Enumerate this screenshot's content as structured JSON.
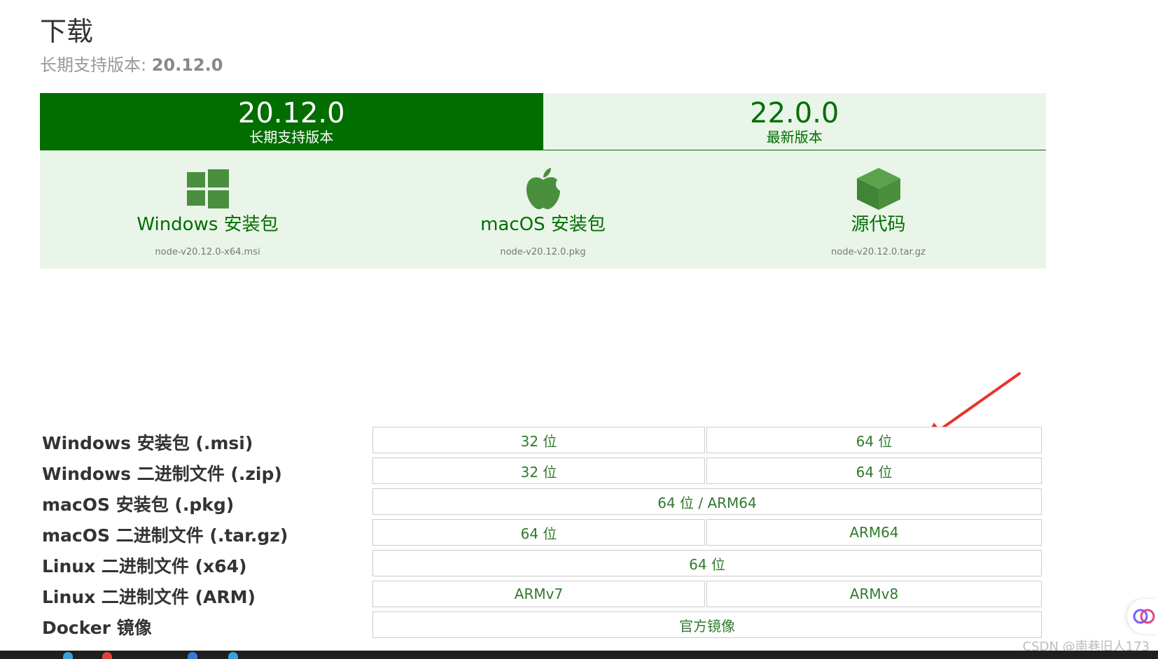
{
  "page": {
    "title": "下载",
    "subtitle_prefix": "长期支持版本: ",
    "subtitle_version": "20.12.0"
  },
  "version_tabs": [
    {
      "version": "20.12.0",
      "label": "长期支持版本"
    },
    {
      "version": "22.0.0",
      "label": "最新版本"
    }
  ],
  "download_cards": [
    {
      "title": "Windows 安装包",
      "file": "node-v20.12.0-x64.msi",
      "icon": "windows-logo-icon"
    },
    {
      "title": "macOS 安装包",
      "file": "node-v20.12.0.pkg",
      "icon": "apple-logo-icon"
    },
    {
      "title": "源代码",
      "file": "node-v20.12.0.tar.gz",
      "icon": "package-box-icon"
    }
  ],
  "downloads_table": [
    {
      "label": "Windows 安装包 (.msi)",
      "left": "32 位",
      "right": "64 位"
    },
    {
      "label": "Windows 二进制文件 (.zip)",
      "left": "32 位",
      "right": "64 位"
    },
    {
      "label": "macOS 安装包 (.pkg)",
      "full": "64 位 / ARM64"
    },
    {
      "label": "macOS 二进制文件 (.tar.gz)",
      "left": "64 位",
      "right": "ARM64"
    },
    {
      "label": "Linux 二进制文件 (x64)",
      "full": "64 位"
    },
    {
      "label": "Linux 二进制文件 (ARM)",
      "left": "ARMv7",
      "right": "ARMv8"
    },
    {
      "label": "Docker 镜像",
      "full": "官方镜像"
    }
  ],
  "watermark": "CSDN @南巷旧人173",
  "colors": {
    "brand_green": "#026e00",
    "light_green_bg": "#e9f5e9",
    "link_green": "#2f7a2f",
    "arrow_red": "#e8322e"
  }
}
